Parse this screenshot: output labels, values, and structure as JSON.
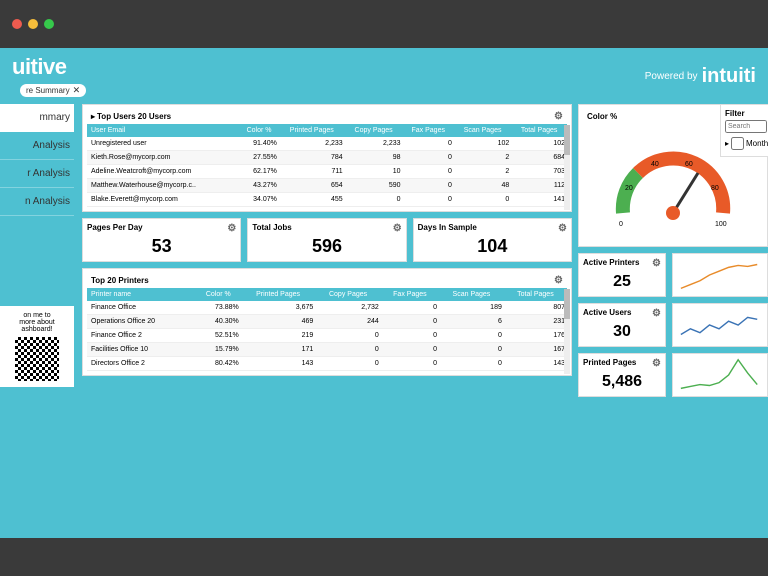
{
  "chrome": {
    "tab_label": "re Summary",
    "close": "✕"
  },
  "logo": "uitive",
  "powered_by": "Powered by",
  "powered_logo": "intuiti",
  "sidebar": {
    "items": [
      {
        "label": "mmary"
      },
      {
        "label": "Analysis"
      },
      {
        "label": "r Analysis"
      },
      {
        "label": "n Analysis"
      }
    ],
    "qr_line1": "on me to",
    "qr_line2": "more about",
    "qr_line3": "ashboard!"
  },
  "top_users": {
    "title": "Top Users 20 Users",
    "headers": [
      "User Email",
      "Color %",
      "Printed Pages",
      "Copy Pages",
      "Fax Pages",
      "Scan Pages",
      "Total Pages"
    ],
    "rows": [
      [
        "Unregistered user",
        "91.40%",
        "2,233",
        "2,233",
        "0",
        "102",
        "102"
      ],
      [
        "Kieth.Rose@mycorp.com",
        "27.55%",
        "784",
        "98",
        "0",
        "2",
        "684"
      ],
      [
        "Adeline.Weatcroft@mycorp.com",
        "62.17%",
        "711",
        "10",
        "0",
        "2",
        "703"
      ],
      [
        "Matthew.Waterhouse@mycorp.c..",
        "43.27%",
        "654",
        "590",
        "0",
        "48",
        "112"
      ],
      [
        "Blake.Everett@mycorp.com",
        "34.07%",
        "455",
        "0",
        "0",
        "0",
        "141"
      ]
    ]
  },
  "kpis": {
    "pages_per_day": {
      "label": "Pages Per Day",
      "value": "53"
    },
    "total_jobs": {
      "label": "Total Jobs",
      "value": "596"
    },
    "days_in_sample": {
      "label": "Days In Sample",
      "value": "104"
    }
  },
  "top_printers": {
    "title": "Top 20 Printers",
    "headers": [
      "Printer name",
      "Color %",
      "Printed Pages",
      "Copy Pages",
      "Fax Pages",
      "Scan Pages",
      "Total Pages"
    ],
    "rows": [
      [
        "Finance Office",
        "73.88%",
        "3,675",
        "2,732",
        "0",
        "189",
        "807"
      ],
      [
        "Operations Office 20",
        "40.30%",
        "469",
        "244",
        "0",
        "6",
        "231"
      ],
      [
        "Finance Office 2",
        "52.51%",
        "219",
        "0",
        "0",
        "0",
        "176"
      ],
      [
        "Facilities Office 10",
        "15.79%",
        "171",
        "0",
        "0",
        "0",
        "167"
      ],
      [
        "Directors Office 2",
        "80.42%",
        "143",
        "0",
        "0",
        "0",
        "143"
      ]
    ]
  },
  "gauge": {
    "title": "Color %",
    "ticks": [
      "0",
      "20",
      "40",
      "60",
      "80",
      "100"
    ],
    "value_pos": 55
  },
  "filter": {
    "title": "Filter",
    "search_placeholder": "Search",
    "month": "Month"
  },
  "side_kpis": {
    "active_printers": {
      "label": "Active Printers",
      "value": "25"
    },
    "active_users": {
      "label": "Active Users",
      "value": "30"
    },
    "printed_pages": {
      "label": "Printed Pages",
      "value": "5,486"
    }
  },
  "chart_data": [
    {
      "type": "gauge",
      "title": "Color %",
      "range": [
        0,
        100
      ],
      "value": 55,
      "segments": [
        {
          "from": 0,
          "to": 20,
          "color": "#4caf50"
        },
        {
          "from": 20,
          "to": 100,
          "color": "#e85a28"
        }
      ]
    },
    {
      "type": "line",
      "title": "Active Printers sparkline",
      "values": [
        10,
        12,
        14,
        18,
        20,
        22,
        24,
        23,
        25,
        25,
        25
      ],
      "color": "#e88b2a"
    },
    {
      "type": "line",
      "title": "Active Users sparkline",
      "values": [
        18,
        22,
        20,
        25,
        23,
        28,
        26,
        30,
        29,
        30,
        30
      ],
      "color": "#3a73b5"
    },
    {
      "type": "line",
      "title": "Printed Pages sparkline",
      "values": [
        800,
        900,
        1100,
        1000,
        1300,
        2000,
        4800,
        3500,
        1500,
        1200,
        1000
      ],
      "color": "#4caf50"
    }
  ]
}
